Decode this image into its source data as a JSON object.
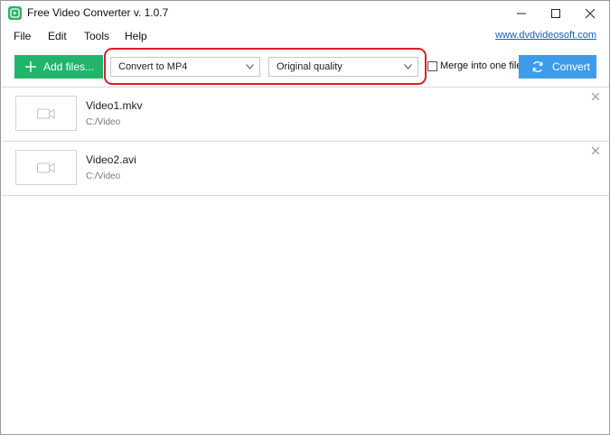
{
  "window": {
    "title": "Free Video Converter v. 1.0.7"
  },
  "menu": {
    "items": [
      "File",
      "Edit",
      "Tools",
      "Help"
    ],
    "site_link": "www.dvdvideosoft.com"
  },
  "toolbar": {
    "add_files_label": "Add files...",
    "format_value": "Convert to MP4",
    "quality_value": "Original quality",
    "merge_label": "Merge into one file",
    "merge_checked": false,
    "convert_label": "Convert"
  },
  "files": [
    {
      "name": "Video1.mkv",
      "path": "C:/Video"
    },
    {
      "name": "Video2.avi",
      "path": "C:/Video"
    }
  ],
  "colors": {
    "add_button": "#20b56b",
    "convert_button": "#3d9be9",
    "highlight": "#d9202a",
    "link": "#1a5fb4"
  }
}
